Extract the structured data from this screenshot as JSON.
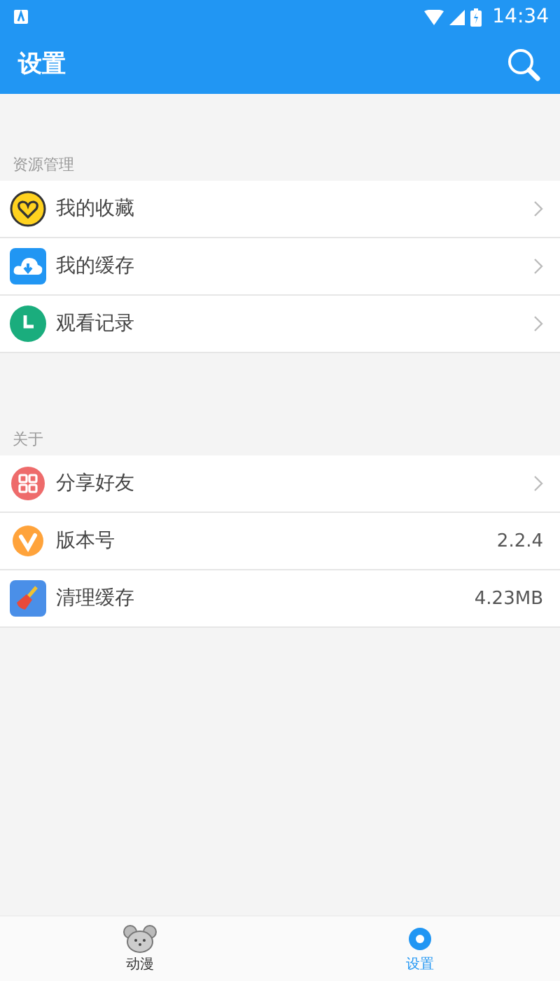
{
  "status_bar": {
    "time": "14:34"
  },
  "app_bar": {
    "title": "设置"
  },
  "sections": [
    {
      "header": "资源管理",
      "items": [
        {
          "label": "我的收藏",
          "kind": "link"
        },
        {
          "label": "我的缓存",
          "kind": "link"
        },
        {
          "label": "观看记录",
          "kind": "link"
        }
      ]
    },
    {
      "header": "关于",
      "items": [
        {
          "label": "分享好友",
          "kind": "link"
        },
        {
          "label": "版本号",
          "kind": "value",
          "value": "2.2.4"
        },
        {
          "label": "清理缓存",
          "kind": "value",
          "value": "4.23MB"
        }
      ]
    }
  ],
  "bottom_nav": [
    {
      "label": "动漫",
      "selected": false
    },
    {
      "label": "设置",
      "selected": true
    }
  ]
}
